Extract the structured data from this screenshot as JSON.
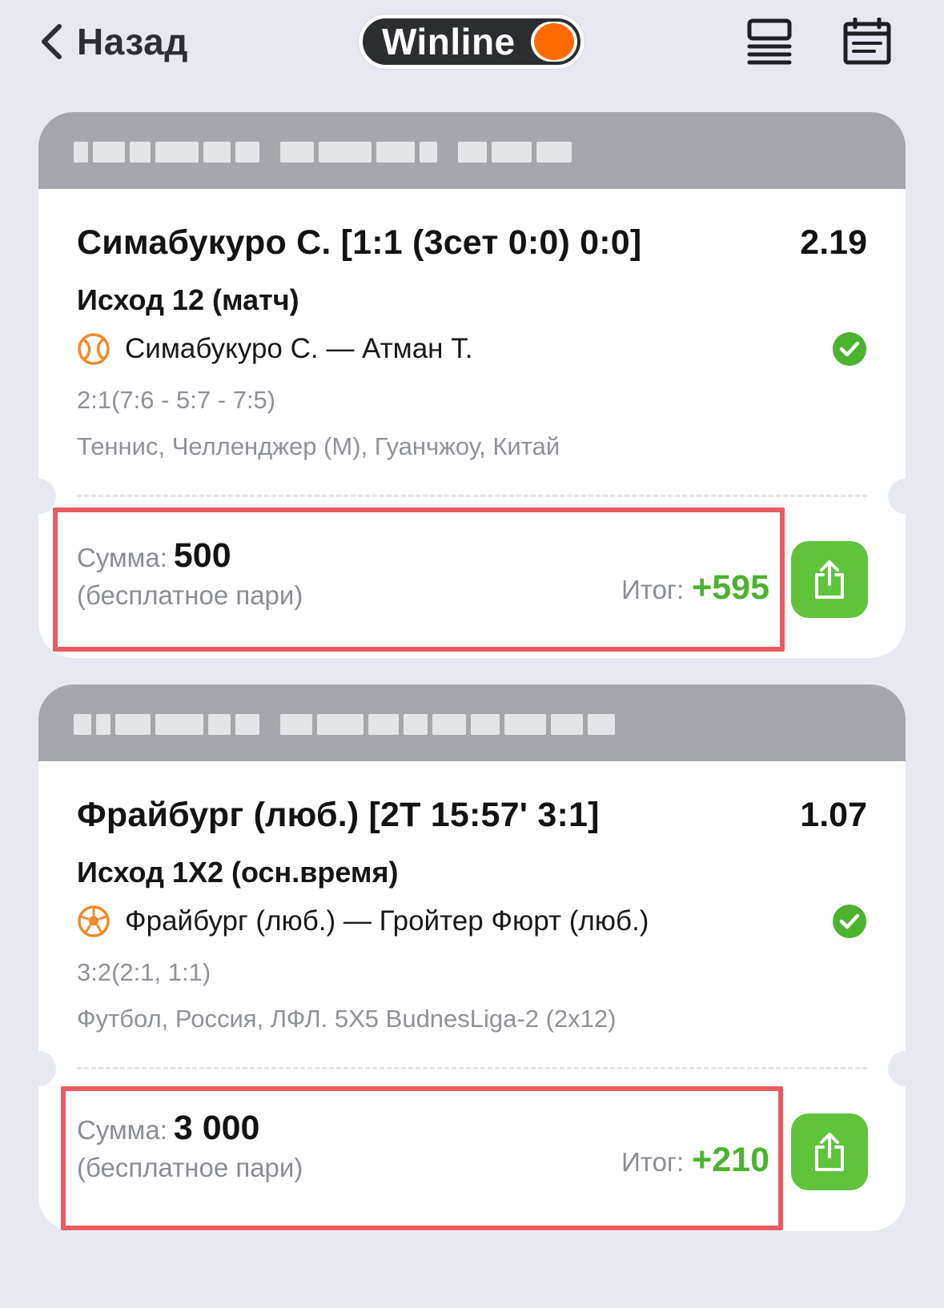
{
  "nav": {
    "back_label": "Назад",
    "logo_text": "Winline"
  },
  "colors": {
    "background": "#e6e9f0",
    "header_gray": "#a4a8ad",
    "accent_orange": "#ff6a00",
    "win_green": "#4cb32e",
    "share_green": "#5fc43c",
    "highlight_red": "#ea5a61"
  },
  "bets": [
    {
      "title": "Симабукуро С. [1:1 (3сет 0:0) 0:0]",
      "odds": "2.19",
      "market": "Исход 12 (матч)",
      "sport_icon": "tennis-ball-icon",
      "teams": "Симабукуро С. — Атман Т.",
      "score": "2:1(7:6 - 5:7 - 7:5)",
      "league": "Теннис,  Челленджер (М), Гуанчжоу, Китай",
      "status_icon": "check-circle-icon",
      "amount_label": "Сумма:",
      "amount_value": "500",
      "amount_note": "(бесплатное пари)",
      "result_label": "Итог:",
      "result_value": "+595"
    },
    {
      "title": "Фрайбург (люб.) [2Т 15:57' 3:1]",
      "odds": "1.07",
      "market": "Исход 1Х2 (осн.время)",
      "sport_icon": "soccer-ball-icon",
      "teams": "Фрайбург (люб.) — Гройтер Фюрт (люб.)",
      "score": "3:2(2:1, 1:1)",
      "league": "Футбол, Россия, ЛФЛ. 5Х5 BudnesLiga-2 (2х12)",
      "status_icon": "check-circle-icon",
      "amount_label": "Сумма:",
      "amount_value": "3 000",
      "amount_note": "(бесплатное пари)",
      "result_label": "Итог:",
      "result_value": "+210"
    }
  ]
}
